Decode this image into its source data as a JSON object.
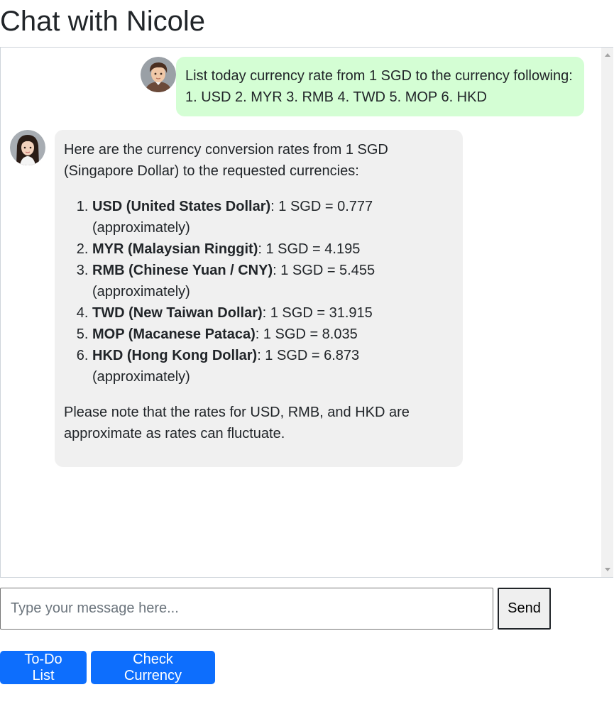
{
  "page": {
    "title": "Chat with Nicole"
  },
  "messages": {
    "user": {
      "avatar": "male-user-avatar",
      "line1": "List today currency rate from 1 SGD to the currency following:",
      "line2": "1. USD 2. MYR 3. RMB 4. TWD 5. MOP 6. HKD"
    },
    "bot": {
      "avatar": "nicole-avatar",
      "intro_line1": "Here are the currency conversion rates from 1 SGD",
      "intro_line2": "(Singapore Dollar) to the requested currencies:",
      "rates": [
        {
          "name": "USD (United States Dollar)",
          "rate": ": 1 SGD = 0.777",
          "note": "(approximately)"
        },
        {
          "name": "MYR (Malaysian Ringgit)",
          "rate": ": 1 SGD = 4.195",
          "note": ""
        },
        {
          "name": "RMB (Chinese Yuan / CNY)",
          "rate": ": 1 SGD = 5.455",
          "note": "(approximately)"
        },
        {
          "name": "TWD (New Taiwan Dollar)",
          "rate": ": 1 SGD = 31.915",
          "note": ""
        },
        {
          "name": "MOP (Macanese Pataca)",
          "rate": ": 1 SGD = 8.035",
          "note": ""
        },
        {
          "name": "HKD (Hong Kong Dollar)",
          "rate": ": 1 SGD = 6.873",
          "note": "(approximately)"
        }
      ],
      "footer_line1": "Please note that the rates for USD, RMB, and HKD are",
      "footer_line2": "approximate as rates can fluctuate."
    }
  },
  "composer": {
    "placeholder": "Type your message here...",
    "value": "",
    "send_label": "Send"
  },
  "actions": {
    "todo_label": "To-Do List",
    "currency_label": "Check Currency"
  },
  "colors": {
    "user_bubble": "#d4fed4",
    "bot_bubble": "#f0f0f0",
    "primary": "#0d6efd"
  }
}
